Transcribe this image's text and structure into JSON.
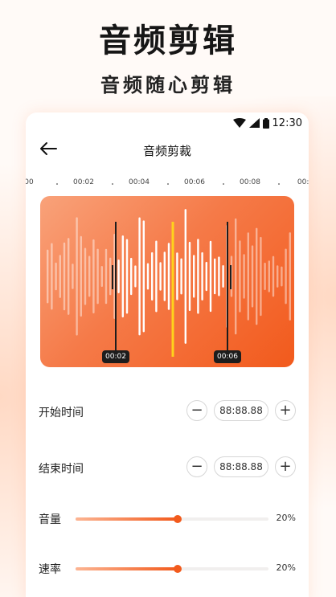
{
  "promo": {
    "headline": "音频剪辑",
    "subline": "音频随心剪辑"
  },
  "status_bar": {
    "time": "12:30",
    "icons": [
      "wifi-icon",
      "signal-icon",
      "battery-icon"
    ]
  },
  "nav": {
    "title": "音频剪裁",
    "back_icon": "back-arrow-icon"
  },
  "timeline": {
    "ticks": [
      "00",
      "00:02",
      "00:04",
      "00:06",
      "00:08",
      "00:0"
    ]
  },
  "waveform": {
    "start_label": "00:02",
    "end_label": "00:06",
    "colors": {
      "gradient_start": "#f9a27a",
      "gradient_end": "#f25a1c",
      "playhead": "#ffd21c",
      "handle": "#1d1d1d"
    }
  },
  "start_time": {
    "label": "开始时间",
    "value": "88:88.88",
    "minus": "−",
    "plus": "+"
  },
  "end_time": {
    "label": "结束时间",
    "value": "88:88.88",
    "minus": "−",
    "plus": "+"
  },
  "volume": {
    "label": "音量",
    "value_text": "20%",
    "level": 0.53
  },
  "speed": {
    "label": "速率",
    "value_text": "20%",
    "level": 0.53
  },
  "accent_color": "#f25a1c"
}
